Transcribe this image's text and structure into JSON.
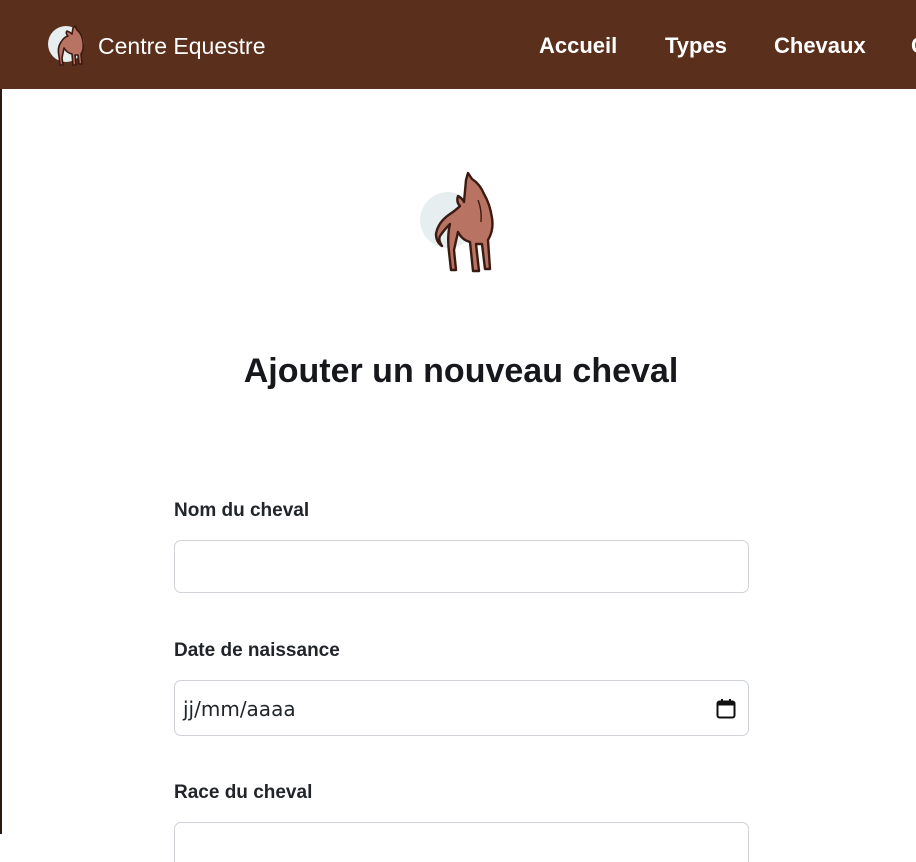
{
  "navbar": {
    "brand_name": "Centre Equestre",
    "links": [
      {
        "label": "Accueil"
      },
      {
        "label": "Types"
      },
      {
        "label": "Chevaux"
      },
      {
        "label": "C"
      }
    ],
    "background_color": "#5a2f1b"
  },
  "hero": {
    "logo_icon": "horse-icon"
  },
  "page": {
    "title": "Ajouter un nouveau cheval"
  },
  "form": {
    "fields": [
      {
        "label": "Nom du cheval",
        "value": "",
        "placeholder": ""
      },
      {
        "label": "Date de naissance",
        "placeholder": "jj/mm/aaaa",
        "icon": "calendar-icon"
      },
      {
        "label": "Race du cheval",
        "value": ""
      }
    ]
  }
}
